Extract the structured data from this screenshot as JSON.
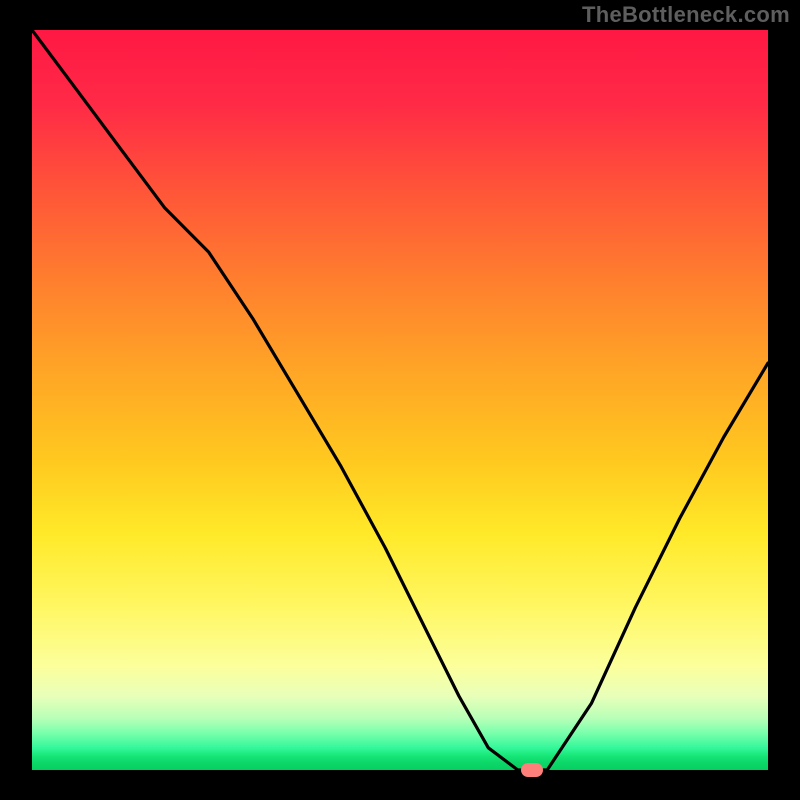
{
  "watermark": "TheBottleneck.com",
  "colors": {
    "frame": "#000000",
    "watermark_text": "#5e5e5e",
    "curve": "#000000",
    "marker": "#ff7f7a",
    "gradient_top": "#ff1844",
    "gradient_bottom": "#05cf60"
  },
  "chart_data": {
    "type": "line",
    "title": "",
    "xlabel": "",
    "ylabel": "",
    "xlim": [
      0,
      100
    ],
    "ylim": [
      0,
      100
    ],
    "series": [
      {
        "name": "bottleneck-curve",
        "x": [
          0,
          6,
          12,
          18,
          24,
          30,
          36,
          42,
          48,
          54,
          58,
          62,
          66,
          70,
          76,
          82,
          88,
          94,
          100
        ],
        "values": [
          100,
          92,
          84,
          76,
          70,
          61,
          51,
          41,
          30,
          18,
          10,
          3,
          0,
          0,
          9,
          22,
          34,
          45,
          55
        ]
      }
    ],
    "marker": {
      "x": 68,
      "y": 0,
      "name": "optimal-point"
    },
    "gradient_meaning": "color band from red (high bottleneck) at top to green (low bottleneck) at bottom"
  }
}
